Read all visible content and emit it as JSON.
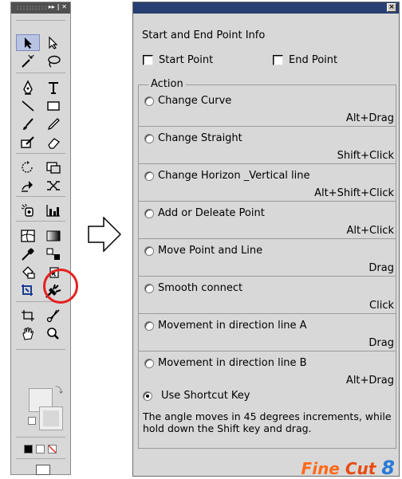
{
  "toolbox": {
    "title_buttons": "▸▸ | ✕",
    "tools": [
      "selection-tool",
      "direct-selection-tool",
      "magic-wand-tool",
      "lasso-tool",
      "pen-tool",
      "type-tool",
      "line-tool",
      "rectangle-tool",
      "paintbrush-tool",
      "pencil-tool",
      "blob-brush-tool",
      "eraser-tool",
      "rotate-tool",
      "scale-tool",
      "warp-tool",
      "free-transform-tool",
      "symbol-sprayer-tool",
      "column-graph-tool",
      "mesh-tool",
      "gradient-tool",
      "eyedropper-tool",
      "blend-tool",
      "live-paint-bucket-tool",
      "live-paint-selection-tool",
      "crop-area-tool",
      "fine-cut-tool",
      "slice-tool",
      "scissors-tool",
      "hand-tool",
      "zoom-tool"
    ],
    "highlighted_tool": "fine-cut-tool",
    "highlight_color": "#e52020"
  },
  "dialog": {
    "close_label": "×",
    "section_title": "Start and End Point Info",
    "start_point_label": "Start Point",
    "end_point_label": "End Point",
    "action_legend": "Action",
    "actions": [
      {
        "label": "Change Curve",
        "key": "Alt+Drag"
      },
      {
        "label": "Change Straight",
        "key": "Shift+Click"
      },
      {
        "label": "Change Horizon _Vertical line",
        "key": "Alt+Shift+Click"
      },
      {
        "label": "Add or Deleate Point",
        "key": "Alt+Click"
      },
      {
        "label": "Move Point and Line",
        "key": "Drag"
      },
      {
        "label": "Smooth connect",
        "key": "Click"
      },
      {
        "label": "Movement in direction line A",
        "key": "Drag"
      },
      {
        "label": "Movement in direction line B",
        "key": "Alt+Drag"
      }
    ],
    "shortcut_label": "Use Shortcut Key",
    "description": "The angle moves in 45 degrees increments, while hold down the Shift key and drag.",
    "logo_part1": "Fine ",
    "logo_part2": "Cut ",
    "logo_part3": "8",
    "colors": {
      "titlebar": "#273f72",
      "panel": "#d8d8d8"
    }
  }
}
